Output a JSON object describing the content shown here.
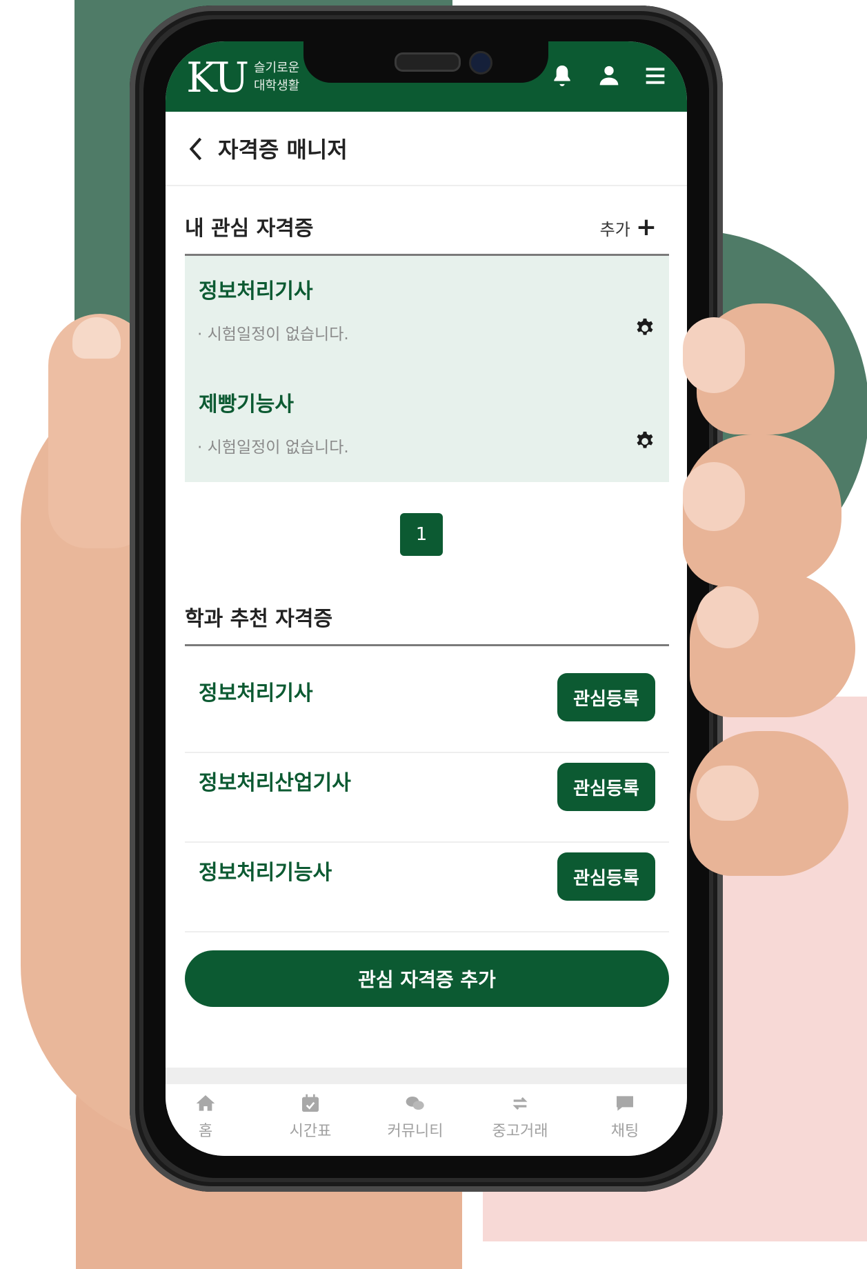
{
  "header": {
    "logo_text": "KU",
    "logo_sub_line1": "슬기로운",
    "logo_sub_line2": "대학생활"
  },
  "page": {
    "title": "자격증 매니저"
  },
  "favorites": {
    "title": "내 관심 자격증",
    "add_label": "추가",
    "items": [
      {
        "name": "정보처리기사",
        "schedule": "· 시험일정이 없습니다."
      },
      {
        "name": "제빵기능사",
        "schedule": "· 시험일정이 없습니다."
      }
    ],
    "page_number": "1"
  },
  "recommended": {
    "title": "학과 추천 자격증",
    "button_label": "관심등록",
    "items": [
      {
        "name": "정보처리기사"
      },
      {
        "name": "정보처리산업기사"
      },
      {
        "name": "정보처리기능사"
      }
    ]
  },
  "add_button_label": "관심 자격증 추가",
  "tabs": [
    {
      "label": "홈",
      "icon": "home-icon"
    },
    {
      "label": "시간표",
      "icon": "calendar-icon"
    },
    {
      "label": "커뮤니티",
      "icon": "chat-bubbles-icon"
    },
    {
      "label": "중고거래",
      "icon": "exchange-icon"
    },
    {
      "label": "채팅",
      "icon": "message-icon"
    }
  ],
  "colors": {
    "brand_green": "#0c5a32",
    "card_bg": "#e7f1ec",
    "bg_green": "#4f7b67",
    "bg_pink": "#f7d9d6"
  }
}
